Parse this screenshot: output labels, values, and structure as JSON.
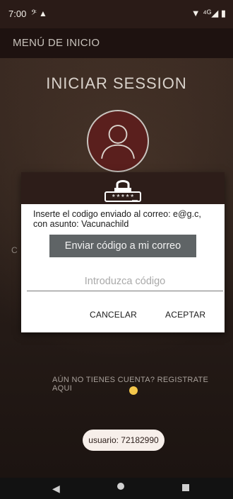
{
  "status_bar": {
    "time": "7:00",
    "left_icons": "𝄢 ▲",
    "right_icons": "▼ ⁴ᴳ◢ ▮"
  },
  "app_bar": {
    "title": "MENÚ DE INICIO"
  },
  "login": {
    "title": "INICIAR SESSION",
    "edge_text": "C"
  },
  "dialog": {
    "message": "Inserte el codigo enviado al correo: e@g.c, con asunto: Vacunachild",
    "send_button": "Enviar código a mi correo",
    "code_placeholder": "Introduzca código",
    "code_value": "",
    "cancel": "CANCELAR",
    "accept": "ACEPTAR",
    "password_mask": "*****"
  },
  "register": {
    "link": "AÚN NO TIENES CUENTA? REGISTRATE AQUI"
  },
  "toast": {
    "text": "usuario: 72182990"
  },
  "nav": {
    "back_icon": "◀"
  },
  "colors": {
    "header_dark": "#2d1d19",
    "button_grey": "#5f6466",
    "avatar_red": "#5a1f1d"
  }
}
